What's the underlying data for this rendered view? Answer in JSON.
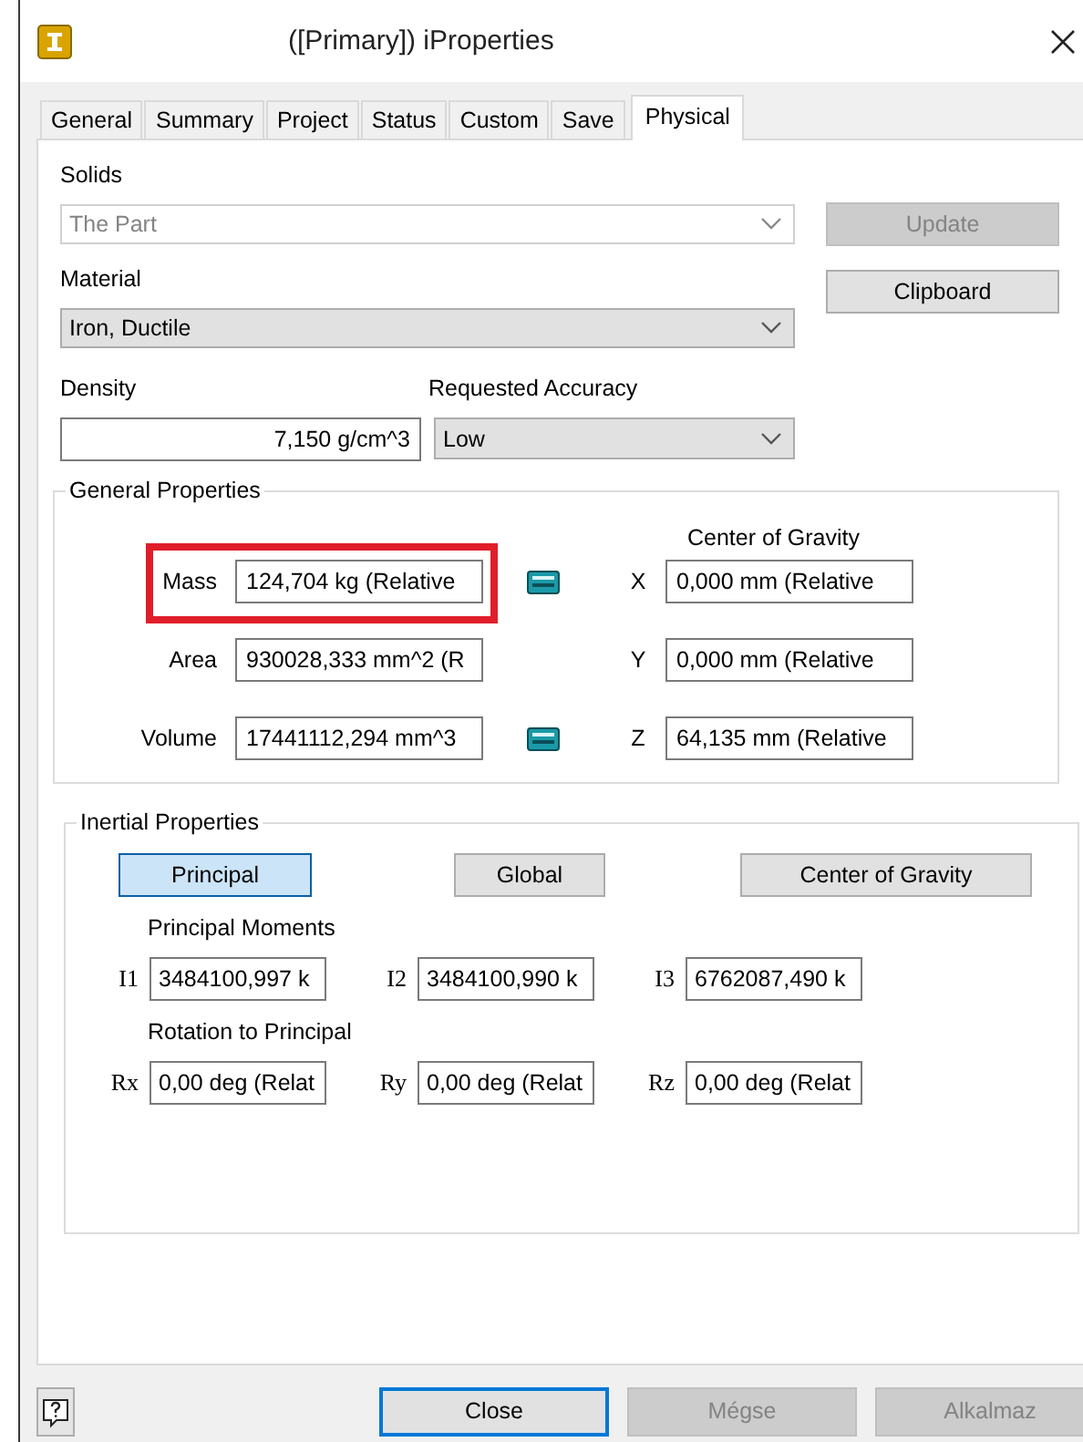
{
  "window": {
    "title": "([Primary]) iProperties"
  },
  "tabs": [
    {
      "label": "General",
      "selected": false
    },
    {
      "label": "Summary",
      "selected": false
    },
    {
      "label": "Project",
      "selected": false
    },
    {
      "label": "Status",
      "selected": false
    },
    {
      "label": "Custom",
      "selected": false
    },
    {
      "label": "Save",
      "selected": false
    },
    {
      "label": "Physical",
      "selected": true
    }
  ],
  "solids": {
    "label": "Solids",
    "value": "The Part",
    "disabled": true
  },
  "update_button": {
    "label": "Update",
    "disabled": true
  },
  "clipboard_button": {
    "label": "Clipboard",
    "disabled": false
  },
  "material": {
    "label": "Material",
    "value": "Iron, Ductile"
  },
  "density": {
    "label": "Density",
    "value": "7,150 g/cm^3"
  },
  "requested_accuracy": {
    "label": "Requested Accuracy",
    "value": "Low"
  },
  "general_properties": {
    "title": "General Properties",
    "center_of_gravity_label": "Center of Gravity",
    "rows": [
      {
        "label": "Mass",
        "value": "124,704 kg (Relative",
        "has_icon": true,
        "highlighted": true,
        "axis": "X",
        "axis_value": "0,000 mm (Relative"
      },
      {
        "label": "Area",
        "value": "930028,333 mm^2 (R",
        "has_icon": false,
        "highlighted": false,
        "axis": "Y",
        "axis_value": "0,000 mm (Relative"
      },
      {
        "label": "Volume",
        "value": "17441112,294 mm^3",
        "has_icon": true,
        "highlighted": false,
        "axis": "Z",
        "axis_value": "64,135 mm (Relative"
      }
    ]
  },
  "inertial_properties": {
    "title": "Inertial Properties",
    "modes": [
      {
        "label": "Principal",
        "selected": true
      },
      {
        "label": "Global",
        "selected": false
      },
      {
        "label": "Center of Gravity",
        "selected": false
      }
    ],
    "moments_label": "Principal Moments",
    "moments": [
      {
        "label": "I1",
        "value": "3484100,997 k"
      },
      {
        "label": "I2",
        "value": "3484100,990 k"
      },
      {
        "label": "I3",
        "value": "6762087,490 k"
      }
    ],
    "rotation_label": "Rotation to Principal",
    "rotations": [
      {
        "label": "Rx",
        "value": "0,00 deg (Relat"
      },
      {
        "label": "Ry",
        "value": "0,00 deg (Relat"
      },
      {
        "label": "Rz",
        "value": "0,00 deg (Relat"
      }
    ]
  },
  "buttons": [
    {
      "label": "Close",
      "disabled": false,
      "focused": true
    },
    {
      "label": "Mégse",
      "disabled": true,
      "focused": false
    },
    {
      "label": "Alkalmaz",
      "disabled": true,
      "focused": false
    }
  ]
}
